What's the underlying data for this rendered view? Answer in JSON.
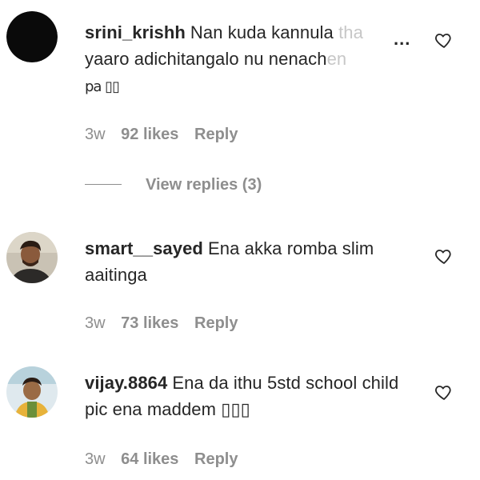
{
  "comments": [
    {
      "username": "srini_krishh",
      "text_main": "Nan kuda kannula ",
      "text_fade": "tha",
      "text_line2_main": "yaaro adichitangalo nu nenach",
      "text_line2_fade": "en",
      "text_line3": "pa ▯▯",
      "time": "3w",
      "likes": "92 likes",
      "reply": "Reply",
      "more": "...",
      "view_replies": "View replies (3)",
      "avatar_icon": "black-circle-avatar"
    },
    {
      "username": "smart__sayed",
      "text": "Ena akka romba slim aaitinga",
      "time": "3w",
      "likes": "73 likes",
      "reply": "Reply",
      "avatar_icon": "man-photo-avatar"
    },
    {
      "username": "vijay.8864",
      "text": "Ena da ithu 5std school child pic ena maddem ▯▯▯",
      "time": "3w",
      "likes": "64 likes",
      "reply": "Reply",
      "avatar_icon": "child-photo-avatar"
    }
  ],
  "icons": {
    "like": "heart-icon"
  },
  "colors": {
    "text": "#262626",
    "secondary": "#8e8e8e",
    "faded": "#c7c7c7"
  }
}
